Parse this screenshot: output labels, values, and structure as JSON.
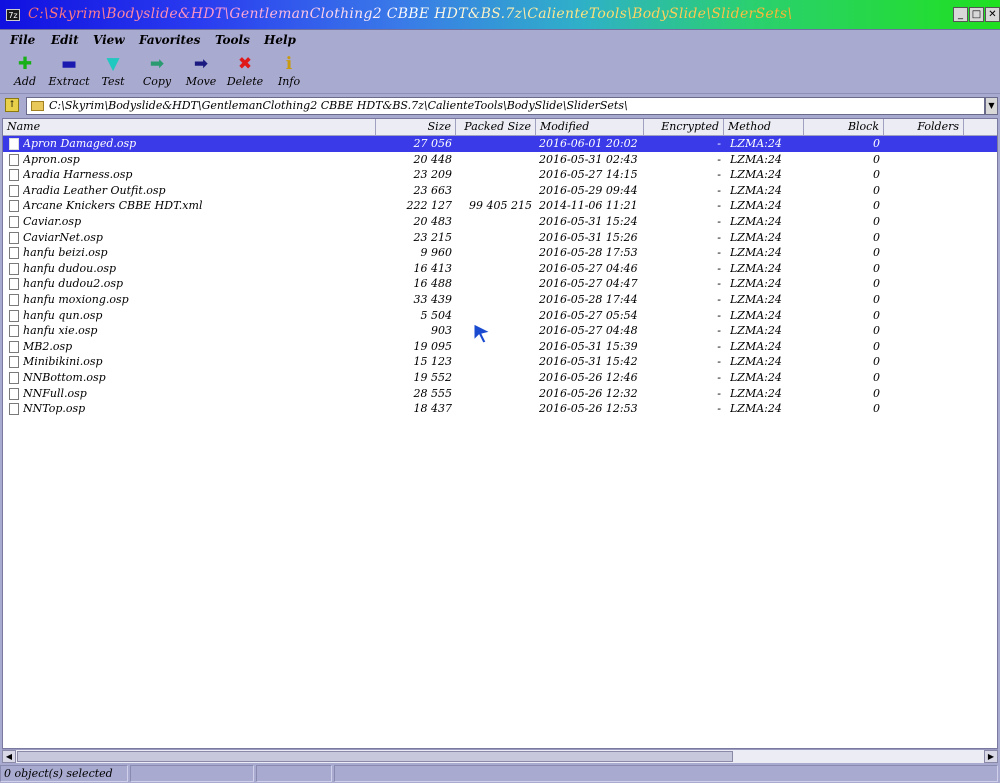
{
  "window": {
    "icon_text": "7z",
    "title": "C:\\Skyrim\\Bodyslide&HDT\\GentlemanClothing2 CBBE HDT&BS.7z\\CalienteTools\\BodySlide\\SliderSets\\",
    "minimize": "_",
    "maximize": "□",
    "close": "✕"
  },
  "menu": [
    "File",
    "Edit",
    "View",
    "Favorites",
    "Tools",
    "Help"
  ],
  "toolbar": [
    {
      "label": "Add",
      "icon": "plus-icon",
      "glyph": "✚",
      "color": "#18b018"
    },
    {
      "label": "Extract",
      "icon": "minus-icon",
      "glyph": "▬",
      "color": "#1a1ab0"
    },
    {
      "label": "Test",
      "icon": "check-down-icon",
      "glyph": "▼",
      "color": "#20c8c0"
    },
    {
      "label": "Copy",
      "icon": "arrow-right-icon",
      "glyph": "➡",
      "color": "#2a9a70"
    },
    {
      "label": "Move",
      "icon": "arrow-right-icon",
      "glyph": "➡",
      "color": "#1a1a80"
    },
    {
      "label": "Delete",
      "icon": "x-icon",
      "glyph": "✖",
      "color": "#e01818"
    },
    {
      "label": "Info",
      "icon": "info-icon",
      "glyph": "ℹ",
      "color": "#c89a10"
    }
  ],
  "address": {
    "path": "C:\\Skyrim\\Bodyslide&HDT\\GentlemanClothing2 CBBE HDT&BS.7z\\CalienteTools\\BodySlide\\SliderSets\\",
    "dropdown": "▼"
  },
  "columns": [
    "Name",
    "Size",
    "Packed Size",
    "Modified",
    "Encrypted",
    "Method",
    "Block",
    "Folders"
  ],
  "files": [
    {
      "name": "Apron Damaged.osp",
      "size": "27 056",
      "packed": "",
      "modified": "2016-06-01 20:02",
      "encrypted": "-",
      "method": "LZMA:24",
      "block": "0",
      "selected": true
    },
    {
      "name": "Apron.osp",
      "size": "20 448",
      "packed": "",
      "modified": "2016-05-31 02:43",
      "encrypted": "-",
      "method": "LZMA:24",
      "block": "0"
    },
    {
      "name": "Aradia Harness.osp",
      "size": "23 209",
      "packed": "",
      "modified": "2016-05-27 14:15",
      "encrypted": "-",
      "method": "LZMA:24",
      "block": "0"
    },
    {
      "name": "Aradia Leather Outfit.osp",
      "size": "23 663",
      "packed": "",
      "modified": "2016-05-29 09:44",
      "encrypted": "-",
      "method": "LZMA:24",
      "block": "0"
    },
    {
      "name": "Arcane Knickers CBBE HDT.xml",
      "size": "222 127",
      "packed": "99 405 215",
      "modified": "2014-11-06 11:21",
      "encrypted": "-",
      "method": "LZMA:24",
      "block": "0"
    },
    {
      "name": "Caviar.osp",
      "size": "20 483",
      "packed": "",
      "modified": "2016-05-31 15:24",
      "encrypted": "-",
      "method": "LZMA:24",
      "block": "0"
    },
    {
      "name": "CaviarNet.osp",
      "size": "23 215",
      "packed": "",
      "modified": "2016-05-31 15:26",
      "encrypted": "-",
      "method": "LZMA:24",
      "block": "0"
    },
    {
      "name": "hanfu beizi.osp",
      "size": "9 960",
      "packed": "",
      "modified": "2016-05-28 17:53",
      "encrypted": "-",
      "method": "LZMA:24",
      "block": "0"
    },
    {
      "name": "hanfu dudou.osp",
      "size": "16 413",
      "packed": "",
      "modified": "2016-05-27 04:46",
      "encrypted": "-",
      "method": "LZMA:24",
      "block": "0"
    },
    {
      "name": "hanfu dudou2.osp",
      "size": "16 488",
      "packed": "",
      "modified": "2016-05-27 04:47",
      "encrypted": "-",
      "method": "LZMA:24",
      "block": "0"
    },
    {
      "name": "hanfu moxiong.osp",
      "size": "33 439",
      "packed": "",
      "modified": "2016-05-28 17:44",
      "encrypted": "-",
      "method": "LZMA:24",
      "block": "0"
    },
    {
      "name": "hanfu qun.osp",
      "size": "5 504",
      "packed": "",
      "modified": "2016-05-27 05:54",
      "encrypted": "-",
      "method": "LZMA:24",
      "block": "0"
    },
    {
      "name": "hanfu xie.osp",
      "size": "903",
      "packed": "",
      "modified": "2016-05-27 04:48",
      "encrypted": "-",
      "method": "LZMA:24",
      "block": "0"
    },
    {
      "name": "MB2.osp",
      "size": "19 095",
      "packed": "",
      "modified": "2016-05-31 15:39",
      "encrypted": "-",
      "method": "LZMA:24",
      "block": "0"
    },
    {
      "name": "Minibikini.osp",
      "size": "15 123",
      "packed": "",
      "modified": "2016-05-31 15:42",
      "encrypted": "-",
      "method": "LZMA:24",
      "block": "0"
    },
    {
      "name": "NNBottom.osp",
      "size": "19 552",
      "packed": "",
      "modified": "2016-05-26 12:46",
      "encrypted": "-",
      "method": "LZMA:24",
      "block": "0"
    },
    {
      "name": "NNFull.osp",
      "size": "28 555",
      "packed": "",
      "modified": "2016-05-26 12:32",
      "encrypted": "-",
      "method": "LZMA:24",
      "block": "0"
    },
    {
      "name": "NNTop.osp",
      "size": "18 437",
      "packed": "",
      "modified": "2016-05-26 12:53",
      "encrypted": "-",
      "method": "LZMA:24",
      "block": "0"
    }
  ],
  "status": {
    "selected": "0 object(s) selected",
    "pane2": "",
    "pane3": "",
    "pane4": ""
  },
  "colors": {
    "background": "#a9aad0",
    "selection": "#3a3ae8",
    "cursor": "#1a4ad0"
  }
}
